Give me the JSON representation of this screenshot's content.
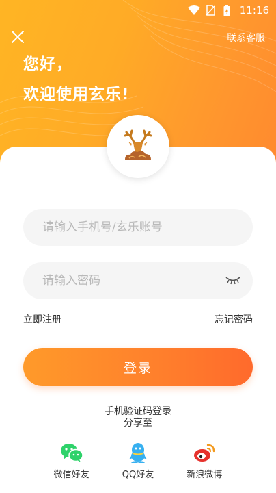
{
  "status_bar": {
    "time": "11:16"
  },
  "header": {
    "contact_label": "联系客服",
    "greeting_line1": "您好，",
    "greeting_line2": "欢迎使用玄乐!"
  },
  "form": {
    "phone_placeholder": "请输入手机号/玄乐账号",
    "phone_value": "",
    "password_placeholder": "请输入密码",
    "password_value": "",
    "register_label": "立即注册",
    "forgot_label": "忘记密码",
    "login_label": "登录",
    "sms_login_label": "手机验证码登录"
  },
  "share": {
    "label": "分享至",
    "items": [
      {
        "label": "微信好友",
        "icon": "wechat-icon",
        "color": "#2ed26a"
      },
      {
        "label": "QQ好友",
        "icon": "qq-icon",
        "color": "#37b0f0"
      },
      {
        "label": "新浪微博",
        "icon": "weibo-icon",
        "color": "#e6322d"
      }
    ]
  },
  "colors": {
    "accent": "#ff8a2f",
    "hero_start": "#ffb524",
    "hero_end": "#ff8a2f"
  }
}
